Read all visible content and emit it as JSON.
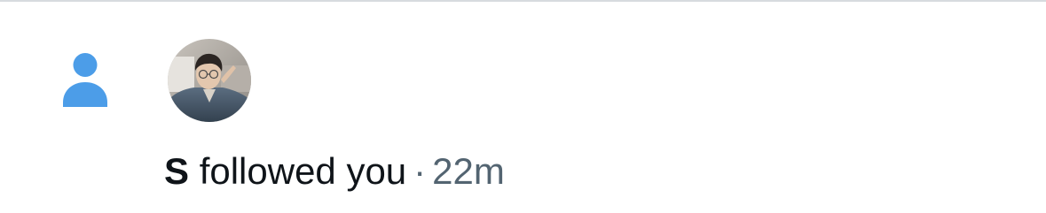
{
  "notification": {
    "type_icon": "person-icon",
    "accent_color": "#4c9de8",
    "username": "S",
    "action": "followed you",
    "separator": "·",
    "time": "22m"
  }
}
